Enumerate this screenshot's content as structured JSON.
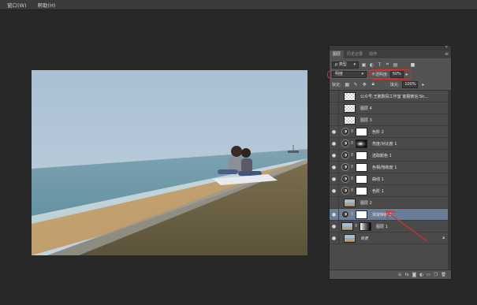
{
  "menu": [
    {
      "label": "窗口(W)"
    },
    {
      "label": "帮助(H)"
    }
  ],
  "panel": {
    "collapse_glyph": "«",
    "menu_glyph": "≡",
    "tabs": [
      {
        "label": "图层",
        "active": true
      },
      {
        "label": "历史记录",
        "active": false
      },
      {
        "label": "动作",
        "active": false
      }
    ],
    "filter": {
      "kind_value": "ρ 类型",
      "toggle_glyph": "■",
      "icons": [
        "image-icon",
        "adjustment-icon",
        "type-icon",
        "shape-icon",
        "smart-object-icon"
      ]
    },
    "blend_mode": "明度",
    "opacity_label": "不透明度:",
    "opacity_value": "50%",
    "lock_label": "锁定:",
    "fill_label": "填充:",
    "fill_value": "100%",
    "layers": [
      {
        "name": "公众号:王鹏数码工作室  客服微信:Sh...",
        "visible": false,
        "thumb": "checker",
        "mask": "none",
        "selected": false
      },
      {
        "name": "图层 4",
        "visible": false,
        "thumb": "checker",
        "mask": "none",
        "selected": false
      },
      {
        "name": "图层 3",
        "visible": false,
        "thumb": "checker",
        "mask": "none",
        "selected": false
      },
      {
        "name": "色阶 2",
        "visible": true,
        "thumb": "adjustment",
        "mask": "white",
        "selected": false
      },
      {
        "name": "亮度/对比度 1",
        "visible": true,
        "thumb": "adjustment",
        "mask": "dark",
        "selected": false
      },
      {
        "name": "选取颜色 1",
        "visible": true,
        "thumb": "adjustment",
        "mask": "white",
        "selected": false
      },
      {
        "name": "色相/饱和度 1",
        "visible": true,
        "thumb": "adjustment",
        "mask": "white",
        "selected": false
      },
      {
        "name": "曲线 1",
        "visible": true,
        "thumb": "adjustment",
        "mask": "white",
        "selected": false
      },
      {
        "name": "色阶 1",
        "visible": true,
        "thumb": "adjustment",
        "mask": "white",
        "selected": false
      },
      {
        "name": "图层 2",
        "visible": false,
        "thumb": "photo",
        "mask": "none",
        "selected": false
      },
      {
        "name": "渐变映射 1",
        "visible": true,
        "thumb": "adjustment",
        "mask": "white",
        "selected": true
      },
      {
        "name": "图层 1",
        "visible": true,
        "thumb": "photo",
        "mask": "grad",
        "selected": false
      },
      {
        "name": "背景",
        "visible": true,
        "thumb": "photo",
        "mask": "none",
        "selected": false,
        "locked": true,
        "italic": true
      }
    ],
    "footer_icons": [
      "link-icon",
      "fx-icon",
      "mask-icon",
      "adjustment-new-icon",
      "group-icon",
      "new-layer-icon",
      "trash-icon"
    ]
  },
  "colors": {
    "annotation_red": "#d9302f",
    "selected_row": "#6a7d96"
  }
}
